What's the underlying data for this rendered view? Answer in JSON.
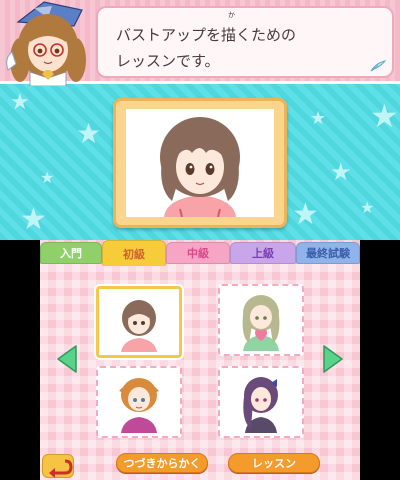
{
  "top": {
    "dialog": {
      "text": "バストアップを描くための\nレッスンです。",
      "furigana": "か"
    },
    "teacher_name": "",
    "preview_subject": "girl-bust-portrait"
  },
  "bottom": {
    "tabs": [
      {
        "label": "入門"
      },
      {
        "label": "初級"
      },
      {
        "label": "中級"
      },
      {
        "label": "上級"
      },
      {
        "label": "最終試験"
      }
    ],
    "selected_tab": "初級",
    "lessons": [
      {
        "subject": "brown-hair-girl",
        "selected": true
      },
      {
        "subject": "green-hair-girl-with-heart",
        "selected": false
      },
      {
        "subject": "orange-hair-girl",
        "selected": false
      },
      {
        "subject": "purple-hair-girl",
        "selected": false
      }
    ],
    "buttons": {
      "continue_label": "つづきからかく",
      "lesson_label": "レッスン"
    }
  },
  "colors": {
    "top_background": "#4fd6df",
    "dialog_band": "#f7c6d3",
    "bottom_background": "#f9c7d4",
    "button_orange": "#f39b2b"
  }
}
